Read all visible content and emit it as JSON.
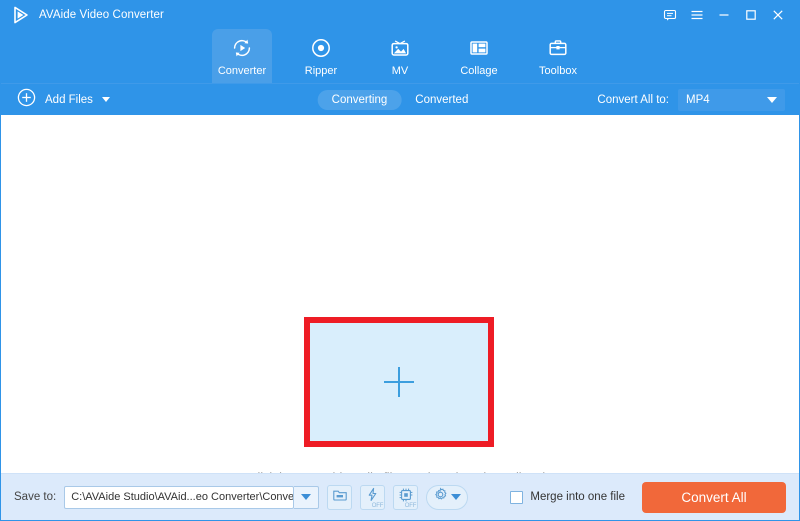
{
  "window": {
    "title": "AVAide Video Converter",
    "logo_icon": "play-triangle-logo",
    "controls": [
      {
        "name": "feedback-icon",
        "glyph": "speech-bubble"
      },
      {
        "name": "menu-icon",
        "glyph": "hamburger"
      },
      {
        "name": "minimize-icon",
        "glyph": "dash"
      },
      {
        "name": "maximize-icon",
        "glyph": "square"
      },
      {
        "name": "close-icon",
        "glyph": "cross"
      }
    ]
  },
  "nav": {
    "tabs": [
      {
        "label": "Converter",
        "icon": "convert-arrows-icon",
        "active": true
      },
      {
        "label": "Ripper",
        "icon": "disc-icon",
        "active": false
      },
      {
        "label": "MV",
        "icon": "tv-photo-icon",
        "active": false
      },
      {
        "label": "Collage",
        "icon": "grid-layout-icon",
        "active": false
      },
      {
        "label": "Toolbox",
        "icon": "toolbox-icon",
        "active": false
      }
    ]
  },
  "toolbar": {
    "add_files_label": "Add Files",
    "add_files_icon": "circle-plus-icon",
    "segments": [
      {
        "label": "Converting",
        "active": true
      },
      {
        "label": "Converted",
        "active": false
      }
    ],
    "convert_all_to_label": "Convert All to:",
    "format_value": "MP4"
  },
  "main": {
    "dropzone_icon": "plus-icon",
    "hint": "Click here to add media files or drag them here directly",
    "highlight_color": "#ee1c25",
    "dropzone_fill": "#d9eefc"
  },
  "bottom": {
    "save_to_label": "Save to:",
    "save_path": "C:\\AVAide Studio\\AVAid...eo Converter\\Converted",
    "buttons": [
      {
        "name": "open-folder-button",
        "icon": "folder-icon"
      },
      {
        "name": "high-speed-conversion-button",
        "icon": "lightning-icon",
        "state": "OFF"
      },
      {
        "name": "hardware-acceleration-button",
        "icon": "gpu-chip-icon",
        "state": "OFF"
      },
      {
        "name": "preferences-button",
        "icon": "gear-icon"
      }
    ],
    "merge_label": "Merge into one file",
    "merge_checked": false,
    "convert_all_label": "Convert All",
    "convert_all_color": "#f1683a"
  },
  "theme": {
    "header_blue": "#2f94e8",
    "active_tab_blue": "#4a9fe8",
    "bottom_bar_blue": "#dceafb"
  }
}
